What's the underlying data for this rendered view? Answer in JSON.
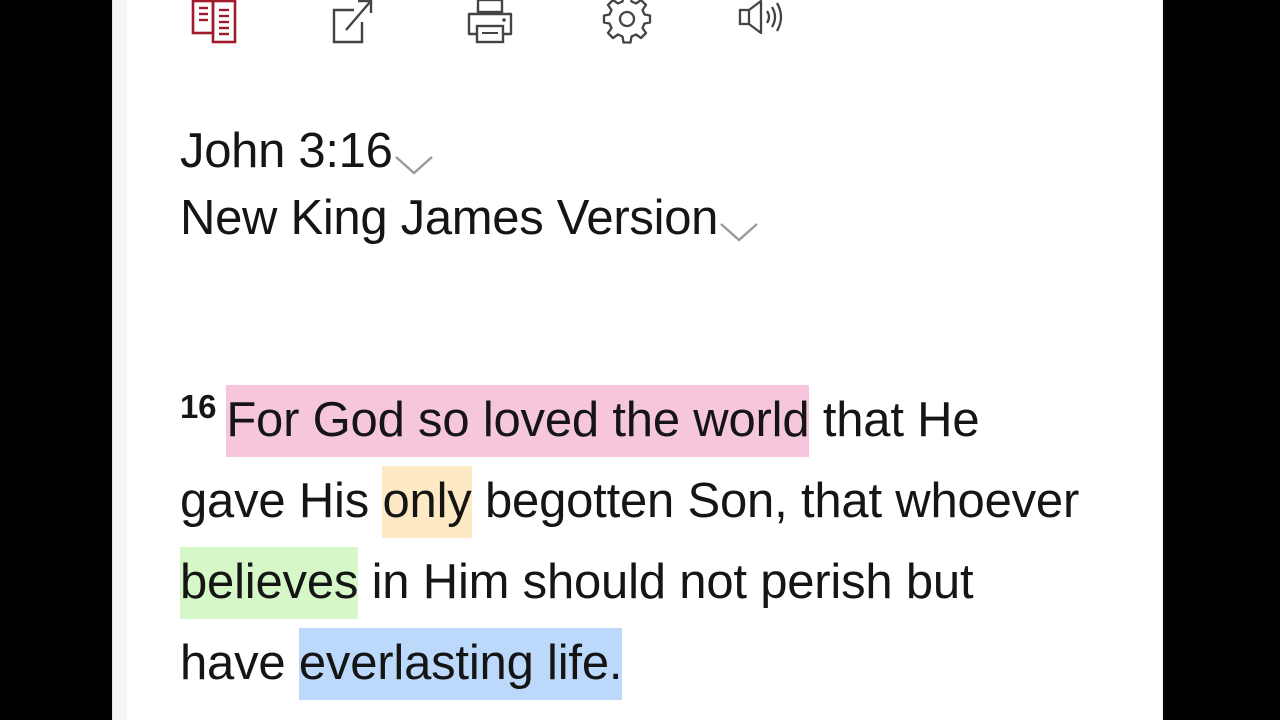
{
  "toolbar": {
    "items": [
      {
        "name": "parallel-view",
        "icon": "parallel-book-icon",
        "color": "#a01c2c"
      },
      {
        "name": "share",
        "icon": "share-icon",
        "color": "#444444"
      },
      {
        "name": "print",
        "icon": "printer-icon",
        "color": "#444444"
      },
      {
        "name": "settings",
        "icon": "gear-icon",
        "color": "#444444"
      },
      {
        "name": "audio",
        "icon": "speaker-icon",
        "color": "#444444"
      }
    ]
  },
  "passage": {
    "reference": "John 3:16",
    "version": "New King James Version",
    "chevron_icon": "chevron-down-icon"
  },
  "verse": {
    "number": "16",
    "segments": [
      {
        "text": "For God so loved the world",
        "highlight": "pink"
      },
      {
        "text": " that He gave His ",
        "highlight": null
      },
      {
        "text": "only",
        "highlight": "yellow"
      },
      {
        "text": " begotten Son, that whoever ",
        "highlight": null
      },
      {
        "text": "believes",
        "highlight": "green"
      },
      {
        "text": " in Him should not perish but have ",
        "highlight": null
      },
      {
        "text": "everlasting life.",
        "highlight": "blue"
      }
    ]
  },
  "colors": {
    "pink_highlight": "#f6c6dc",
    "yellow_highlight": "#fde9c3",
    "green_highlight": "#d6f8c8",
    "blue_highlight": "#bcd9fb",
    "accent": "#a01c2c"
  }
}
